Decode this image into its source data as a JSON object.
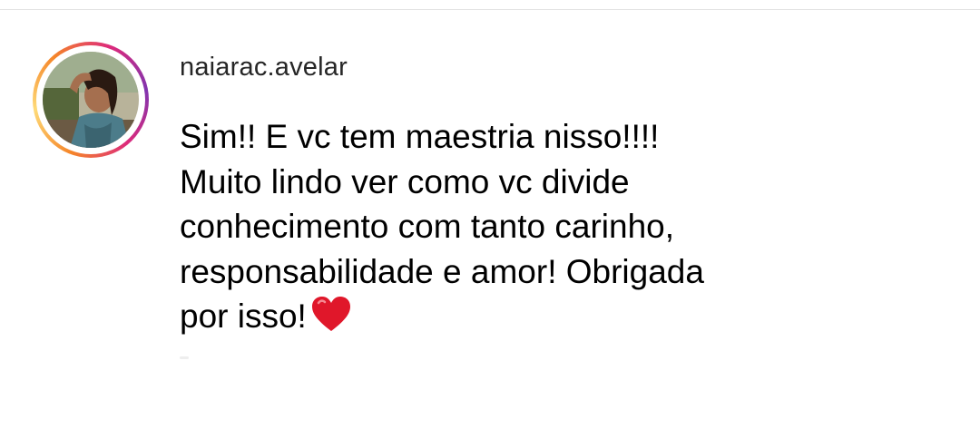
{
  "comment": {
    "username": "naiarac.avelar",
    "lines": [
      "Sim!! E vc tem maestria nisso!!!!",
      "Muito lindo ver como vc divide",
      "conhecimento com tanto carinho,",
      "responsabilidade e amor! Obrigada",
      "por isso!"
    ],
    "emoji": "heart-icon",
    "avatar": "profile-photo"
  },
  "colors": {
    "text": "#000000",
    "username": "#262626",
    "ring_start": "#f58529",
    "ring_end": "#dd2a7b",
    "heart": "#e0172a"
  }
}
